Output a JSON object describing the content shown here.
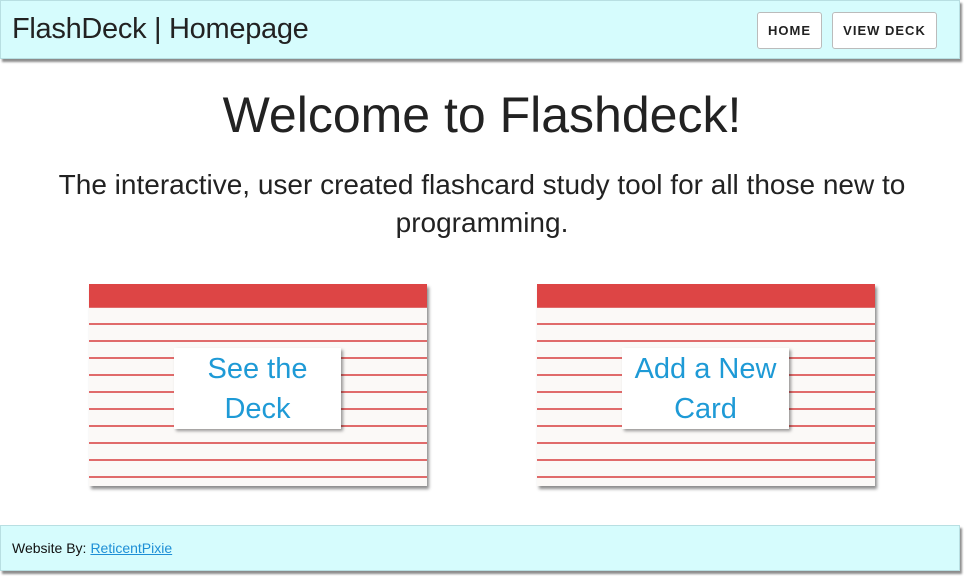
{
  "navbar": {
    "brand": "FlashDeck | Homepage",
    "home_label": "HOME",
    "view_deck_label": "VIEW DECK"
  },
  "main": {
    "heading": "Welcome to Flashdeck!",
    "tagline": "The interactive, user created flashcard study tool for all those new to programming."
  },
  "cards": [
    {
      "label": "See the Deck"
    },
    {
      "label": "Add a New Card"
    }
  ],
  "footer": {
    "prefix": "Website By:",
    "author_link": "ReticentPixie"
  },
  "colors": {
    "nav_bg": "#d6fcfd",
    "card_header": "#dd4545",
    "card_lines": "#e06b6b",
    "link": "#1e9ad6"
  }
}
